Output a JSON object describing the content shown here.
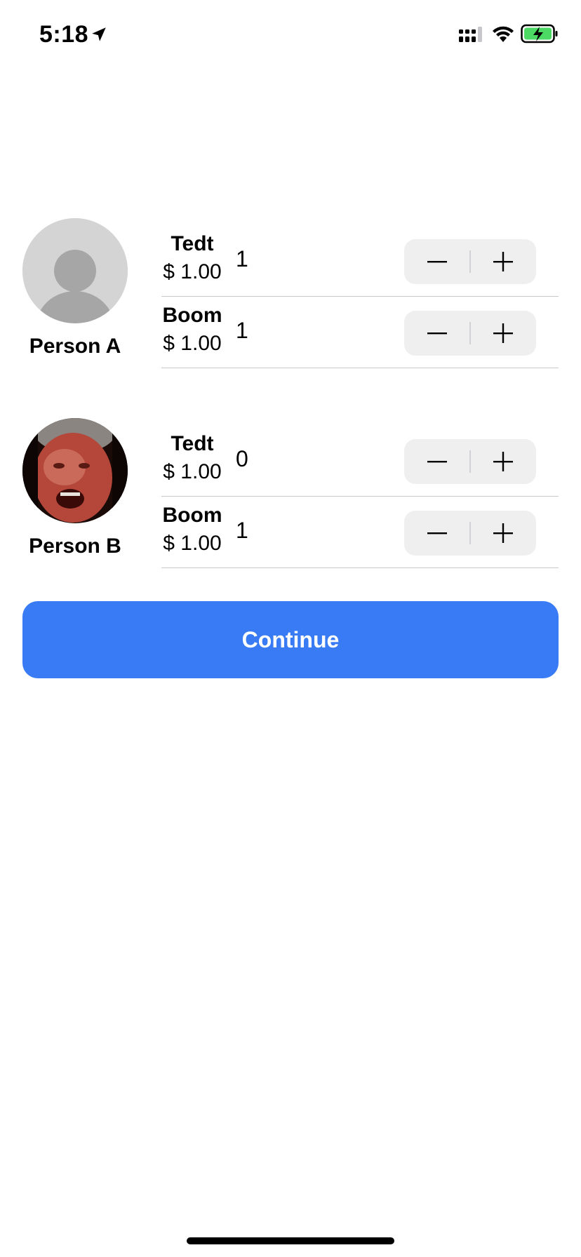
{
  "status_bar": {
    "time": "5:18",
    "icons": [
      "location-arrow-icon",
      "signal-icon",
      "wifi-icon",
      "battery-charging-icon"
    ],
    "battery_color": "#4cd964"
  },
  "people": [
    {
      "name": "Person A",
      "avatar": "default-avatar",
      "items": [
        {
          "name": "Tedt",
          "price": "$ 1.00",
          "quantity": "1"
        },
        {
          "name": "Boom",
          "price": "$ 1.00",
          "quantity": "1"
        }
      ]
    },
    {
      "name": "Person B",
      "avatar": "photo-avatar",
      "items": [
        {
          "name": "Tedt",
          "price": "$ 1.00",
          "quantity": "0"
        },
        {
          "name": "Boom",
          "price": "$ 1.00",
          "quantity": "1"
        }
      ]
    }
  ],
  "continue_button": {
    "label": "Continue",
    "color": "#387bf4"
  }
}
